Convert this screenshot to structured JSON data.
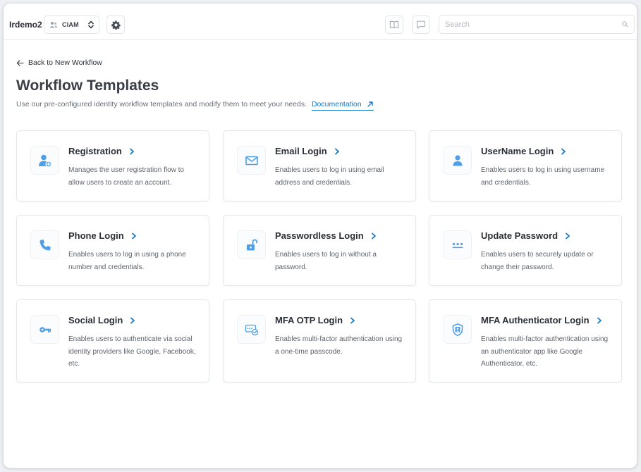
{
  "topbar": {
    "org_name": "Irdemo2",
    "environment": "CIAM",
    "search_placeholder": "Search"
  },
  "header": {
    "back_label": "Back to New Workflow",
    "title": "Workflow Templates",
    "subtitle": "Use our pre-configured identity workflow templates and modify them to meet your needs.",
    "doc_link": "Documentation"
  },
  "accent_color": "#1677c9",
  "icon_color": "#4f9ee8",
  "cards": [
    {
      "title": "Registration",
      "description": "Manages the user registration flow to allow users to create an account.",
      "icon": "user-add-icon"
    },
    {
      "title": "Email Login",
      "description": "Enables users to log in using email address and credentials.",
      "icon": "envelope-icon"
    },
    {
      "title": "UserName Login",
      "description": "Enables users to log in using username and credentials.",
      "icon": "user-icon"
    },
    {
      "title": "Phone Login",
      "description": "Enables users to log in using a phone number and credentials.",
      "icon": "phone-icon"
    },
    {
      "title": "Passwordless Login",
      "description": "Enables users to log in without a password.",
      "icon": "unlock-icon"
    },
    {
      "title": "Update Password",
      "description": "Enables users to securely update or change their password.",
      "icon": "password-dots-icon"
    },
    {
      "title": "Social Login",
      "description": "Enables users to authenticate via social identity providers like Google, Facebook, etc.",
      "icon": "key-icon"
    },
    {
      "title": "MFA OTP Login",
      "description": "Enables multi-factor authentication using a one-time passcode.",
      "icon": "otp-check-icon"
    },
    {
      "title": "MFA Authenticator Login",
      "description": "Enables multi-factor authentication using an authenticator app like Google Authenticator, etc.",
      "icon": "shield-user-icon"
    }
  ]
}
